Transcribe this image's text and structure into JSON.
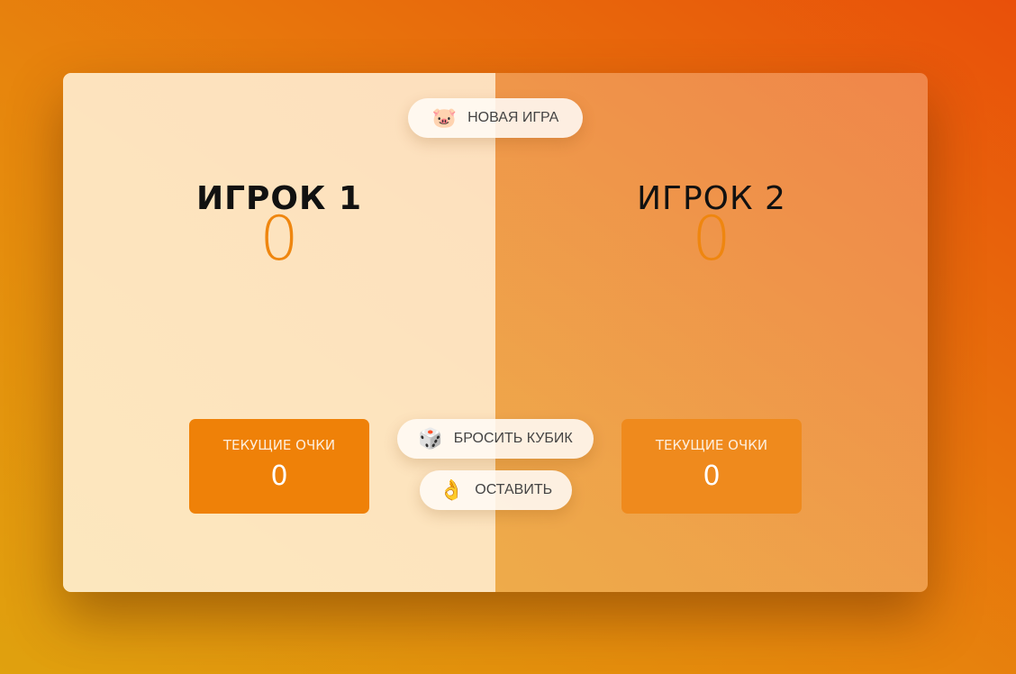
{
  "players": [
    {
      "name": "ИГРОК 1",
      "score": "0",
      "current_label": "ТЕКУЩИЕ ОЧКИ",
      "current_score": "0",
      "active": true
    },
    {
      "name": "ИГРОК 2",
      "score": "0",
      "current_label": "ТЕКУЩИЕ ОЧКИ",
      "current_score": "0",
      "active": false
    }
  ],
  "buttons": {
    "new_game": {
      "label": "НОВАЯ ИГРА",
      "icon": "pig-face-icon",
      "glyph": "🐷"
    },
    "roll": {
      "label": "БРОСИТЬ КУБИК",
      "icon": "dice-icon",
      "glyph": "🎲"
    },
    "hold": {
      "label": "ОСТАВИТЬ",
      "icon": "ok-hand-icon",
      "glyph": "👌"
    }
  },
  "colors": {
    "accent": "#ef860f",
    "current_box_active": "#ef8108",
    "current_box_inactive": "#ef8a1d",
    "background_start": "#e0a10e",
    "background_end": "#e9500a"
  }
}
